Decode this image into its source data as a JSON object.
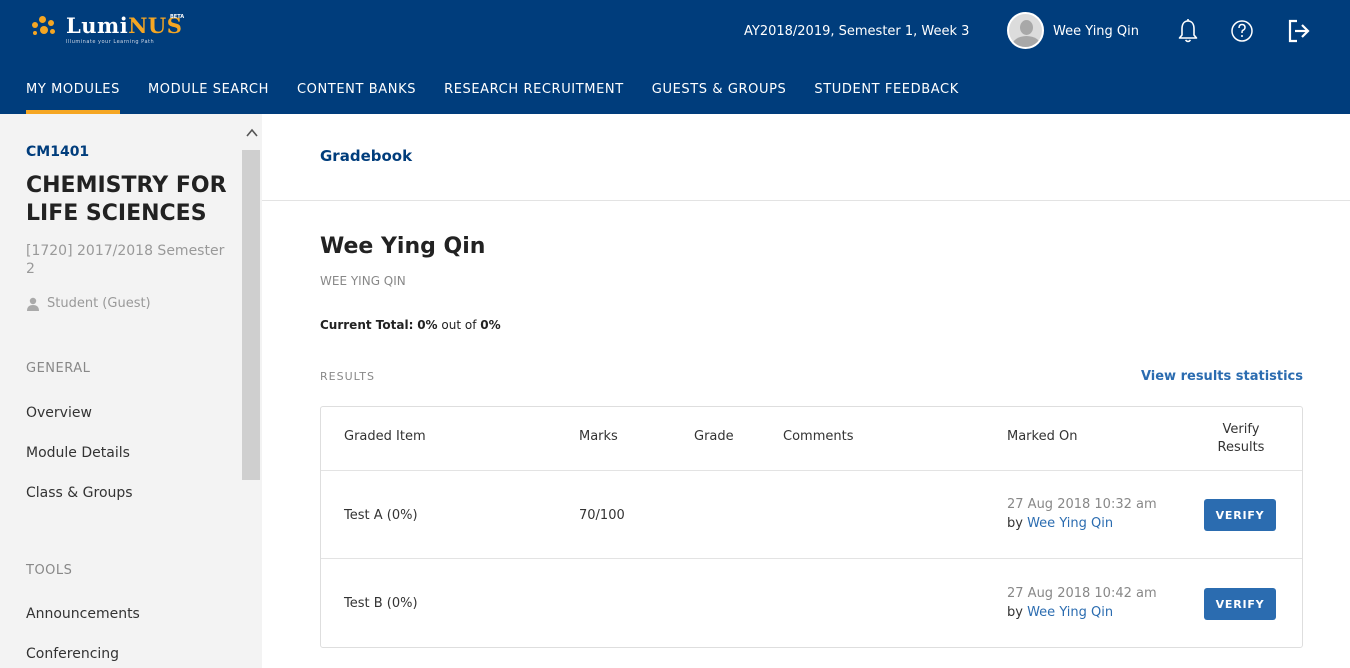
{
  "header": {
    "logo_text_main": "Lumi",
    "logo_text_accent": "NUS",
    "logo_tagline": "Illuminate your Learning Path",
    "logo_badge": "BETA",
    "term": "AY2018/2019, Semester 1, Week 3",
    "user_name": "Wee Ying Qin",
    "icons": [
      "bell-icon",
      "help-icon",
      "logout-icon"
    ],
    "accent_color": "#f5a623",
    "brand_color": "#003d7c"
  },
  "nav": {
    "items": [
      {
        "label": "MY MODULES",
        "active": true
      },
      {
        "label": "MODULE SEARCH",
        "active": false
      },
      {
        "label": "CONTENT BANKS",
        "active": false
      },
      {
        "label": "RESEARCH RECRUITMENT",
        "active": false
      },
      {
        "label": "GUESTS & GROUPS",
        "active": false
      },
      {
        "label": "STUDENT FEEDBACK",
        "active": false
      }
    ]
  },
  "sidebar": {
    "module_code": "CM1401",
    "module_name": "CHEMISTRY FOR LIFE SCIENCES",
    "module_term": "[1720] 2017/2018 Semester 2",
    "role": "Student (Guest)",
    "general_heading": "GENERAL",
    "general_links": [
      "Overview",
      "Module Details",
      "Class & Groups"
    ],
    "tools_heading": "TOOLS",
    "tools_links": [
      "Announcements",
      "Conferencing"
    ]
  },
  "main": {
    "breadcrumb": "Gradebook",
    "student_name": "Wee Ying Qin",
    "student_sub": "WEE YING QIN",
    "total_label": "Current Total:",
    "total_value": "0%",
    "total_out_of": "out of",
    "total_max": "0%",
    "results_heading": "RESULTS",
    "stats_link": "View results statistics",
    "columns": {
      "item": "Graded Item",
      "marks": "Marks",
      "grade": "Grade",
      "comments": "Comments",
      "marked_on": "Marked On",
      "verify_line1": "Verify",
      "verify_line2": "Results"
    },
    "rows": [
      {
        "item": "Test A (0%)",
        "marks": "70/100",
        "grade": "",
        "comments": "",
        "marked_on": "27 Aug 2018 10:32 am",
        "by": "by",
        "marker": "Wee Ying Qin",
        "button": "VERIFY"
      },
      {
        "item": "Test B (0%)",
        "marks": "",
        "grade": "",
        "comments": "",
        "marked_on": "27 Aug 2018 10:42 am",
        "by": "by",
        "marker": "Wee Ying Qin",
        "button": "VERIFY"
      }
    ]
  }
}
